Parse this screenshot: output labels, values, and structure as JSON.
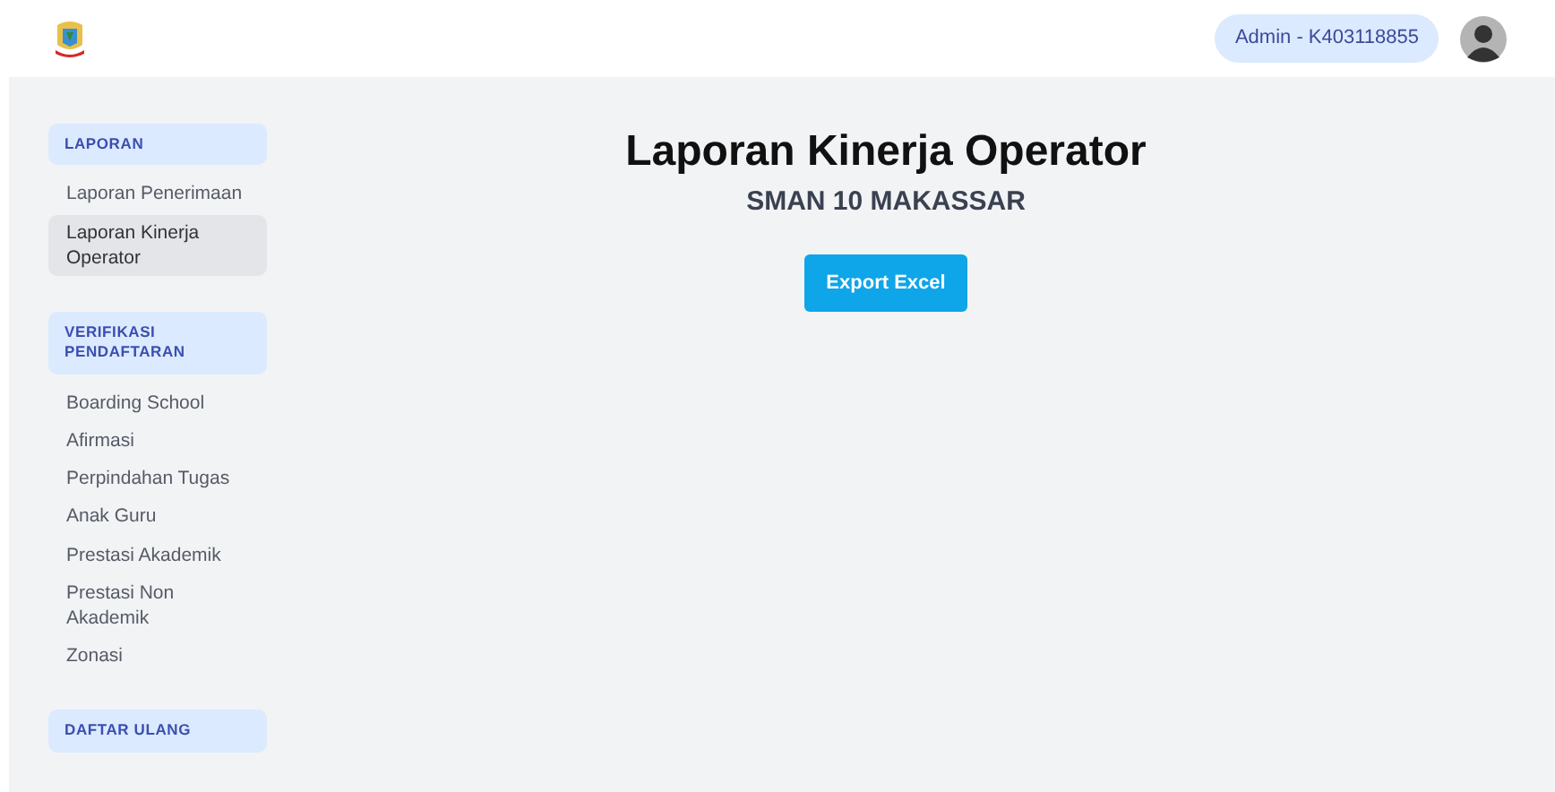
{
  "header": {
    "user_badge": "Admin - K403118855"
  },
  "sidebar": {
    "sections": [
      {
        "title": "LAPORAN",
        "items": [
          {
            "label": "Laporan Penerimaan",
            "selected": false
          },
          {
            "label": "Laporan Kinerja Operator",
            "selected": true
          }
        ]
      },
      {
        "title": "VERIFIKASI PENDAFTARAN",
        "items": [
          {
            "label": "Boarding School",
            "selected": false
          },
          {
            "label": "Afirmasi",
            "selected": false
          },
          {
            "label": "Perpindahan Tugas",
            "selected": false
          },
          {
            "label": "Anak Guru",
            "selected": false
          },
          {
            "label": "Prestasi Akademik",
            "selected": false
          },
          {
            "label": "Prestasi Non Akademik",
            "selected": false
          },
          {
            "label": "Zonasi",
            "selected": false
          }
        ]
      },
      {
        "title": "DAFTAR ULANG"
      }
    ]
  },
  "main": {
    "title": "Laporan Kinerja Operator",
    "subtitle": "SMAN 10 MAKASSAR",
    "button": "Export Excel"
  }
}
